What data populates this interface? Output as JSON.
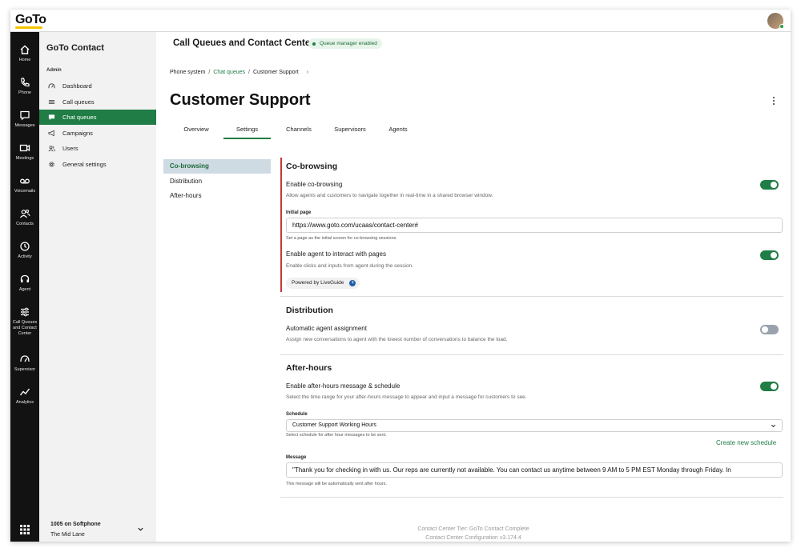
{
  "brand": {
    "logo_text": "GoTo"
  },
  "rail": {
    "items": [
      {
        "label": "Home",
        "icon": "home-icon"
      },
      {
        "label": "Phone",
        "icon": "phone-icon"
      },
      {
        "label": "Messages",
        "icon": "messages-icon"
      },
      {
        "label": "Meetings",
        "icon": "video-icon"
      },
      {
        "label": "Voicemails",
        "icon": "voicemail-icon"
      },
      {
        "label": "Contacts",
        "icon": "contacts-icon"
      },
      {
        "label": "Activity",
        "icon": "activity-icon"
      },
      {
        "label": "Agent",
        "icon": "headset-icon"
      },
      {
        "label_lines": [
          "Call Queues",
          "and Contact",
          "Center"
        ],
        "icon": "sliders-icon"
      },
      {
        "label": "Supervisor",
        "icon": "gauge-icon"
      },
      {
        "label": "Analytics",
        "icon": "analytics-icon"
      }
    ]
  },
  "sidenav": {
    "title": "GoTo Contact",
    "section": "Admin",
    "items": [
      {
        "label": "Dashboard",
        "icon": "dashboard-icon"
      },
      {
        "label": "Call queues",
        "icon": "list-icon"
      },
      {
        "label": "Chat queues",
        "icon": "chat-icon",
        "active": true
      },
      {
        "label": "Campaigns",
        "icon": "campaign-icon"
      },
      {
        "label": "Users",
        "icon": "users-icon"
      },
      {
        "label": "General settings",
        "icon": "gear-icon"
      }
    ],
    "footer": {
      "extension": "1005 on Softphone",
      "name": "The Mid Lane"
    }
  },
  "header": {
    "title": "Call Queues and Contact Center",
    "badge": "Queue manager enabled"
  },
  "breadcrumb": {
    "items": [
      "Phone system",
      "Chat queues",
      "Customer Support"
    ],
    "separator": "/"
  },
  "page": {
    "title": "Customer Support"
  },
  "tabs": [
    "Overview",
    "Settings",
    "Channels",
    "Supervisors",
    "Agents"
  ],
  "active_tab": "Settings",
  "subnav": [
    "Co-browsing",
    "Distribution",
    "After-hours"
  ],
  "cobrowsing": {
    "heading": "Co-browsing",
    "enable_title": "Enable co-browsing",
    "enable_desc": "Allow agents and customers to navigate together in real-time in a shared browser window.",
    "enable_on": true,
    "initial_page_label": "Initial page",
    "initial_page_value": "https://www.goto.com/ucaas/contact-center#",
    "initial_page_help": "Set a page as the initial screen for co-browsing sessions.",
    "interact_title": "Enable agent to interact with pages",
    "interact_desc": "Enable clicks and inputs from agent during the session.",
    "interact_on": true,
    "powered_by": "Powered by LiveGuide"
  },
  "distribution": {
    "heading": "Distribution",
    "auto_title": "Automatic agent assignment",
    "auto_desc": "Assign new conversations to agent with the lowest number of conversations to balance the load.",
    "auto_on": false
  },
  "afterhours": {
    "heading": "After-hours",
    "enable_title": "Enable after-hours message & schedule",
    "enable_desc": "Select the time range for your after-hours message to appear and input a message for customers to see.",
    "enable_on": true,
    "schedule_label": "Schedule",
    "schedule_value": "Customer Support Working Hours",
    "schedule_help": "Select schedule for after hour messages to be sent.",
    "create_link": "Create new schedule",
    "message_label": "Message",
    "message_value": "\"Thank you for checking in with us. Our reps are currently not available. You can contact us anytime between 9 AM to 5 PM EST Monday through Friday. In",
    "message_help": "This message will be automatically sent after hours."
  },
  "footer": {
    "tier": "Contact Center Tier: GoTo Contact Complete",
    "version": "Contact Center Configuration v3.174.4"
  },
  "colors": {
    "accent": "#1f7d45",
    "rail": "#121212",
    "sidenav": "#f2f2f2",
    "logo_underline": "#f5c400"
  }
}
